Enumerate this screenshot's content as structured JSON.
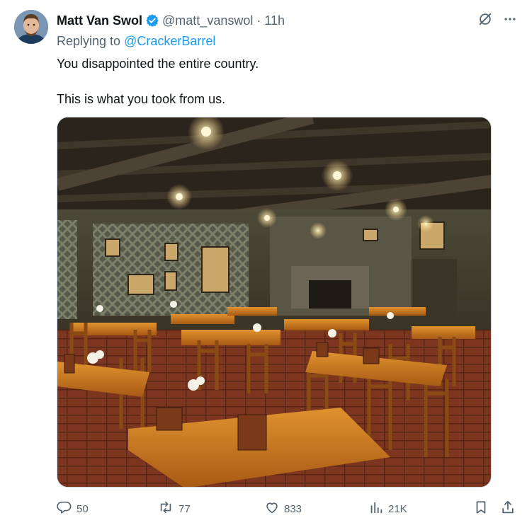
{
  "author": {
    "display_name": "Matt Van Swol",
    "handle": "@matt_vanswol",
    "separator": "·",
    "time": "11h",
    "verified": true
  },
  "reply": {
    "prefix": "Replying to ",
    "mention": "@CrackerBarrel"
  },
  "text": {
    "line1": "You disappointed the entire country.",
    "line2": "This is what you took from us."
  },
  "media": {
    "description_icon": "photo-restaurant-interior"
  },
  "actions": {
    "replies": "50",
    "reposts": "77",
    "likes": "833",
    "views": "21K"
  },
  "icons": {
    "verified": "verified-badge-icon",
    "grok": "grok-icon",
    "more": "more-icon",
    "reply": "reply-icon",
    "repost": "repost-icon",
    "like": "heart-icon",
    "views": "views-icon",
    "bookmark": "bookmark-icon",
    "share": "share-icon"
  },
  "colors": {
    "accent": "#1d9bf0",
    "secondary_text": "#536471",
    "primary_text": "#0f1419"
  }
}
